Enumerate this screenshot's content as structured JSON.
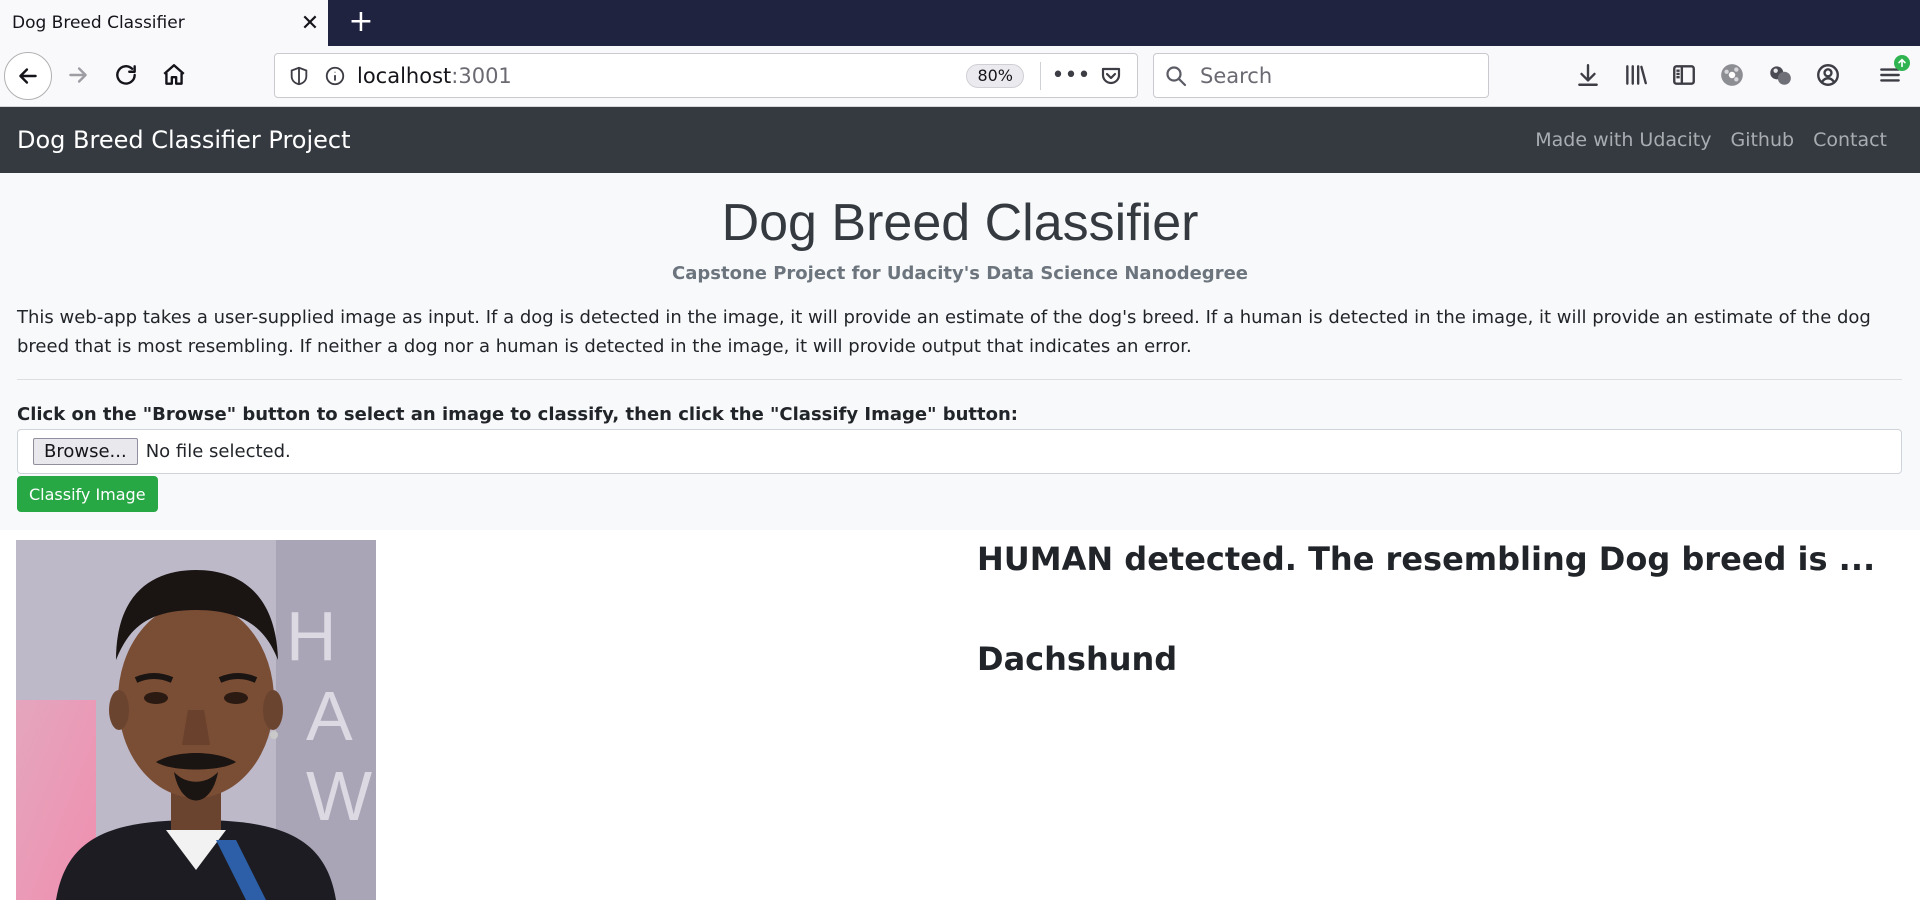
{
  "browser": {
    "tab_title": "Dog Breed Classifier",
    "url_host": "localhost",
    "url_port": ":3001",
    "zoom": "80%",
    "search_placeholder": "Search"
  },
  "nav": {
    "brand": "Dog Breed Classifier Project",
    "links": [
      "Made with Udacity",
      "Github",
      "Contact"
    ]
  },
  "hero": {
    "title": "Dog Breed Classifier",
    "subtitle": "Capstone Project for Udacity's Data Science Nanodegree",
    "description": "This web-app takes a user-supplied image as input. If a dog is detected in the image, it will provide an estimate of the dog's breed. If a human is detected in the image, it will provide an estimate of the dog breed that is most resembling. If neither a dog nor a human is detected in the image, it will provide output that indicates an error.",
    "upload_instruction": "Click on the \"Browse\" button to select an image to classify, then click the \"Classify Image\" button:",
    "browse_label": "Browse...",
    "file_status": "No file selected.",
    "classify_label": "Classify Image"
  },
  "result": {
    "heading": "HUMAN detected. The resembling Dog breed is ...",
    "breed": "Dachshund"
  },
  "colors": {
    "tabbar_bg": "#202340",
    "navbar_bg": "#343a40",
    "classify_green": "#28a745",
    "jumbotron_bg": "#f8f9fa"
  },
  "icons": [
    "back-icon",
    "forward-icon",
    "reload-icon",
    "home-icon",
    "shield-icon",
    "info-icon",
    "more-icon",
    "pocket-icon",
    "search-icon",
    "download-icon",
    "library-icon",
    "sidebar-icon",
    "extension-icon",
    "extension-icon",
    "account-icon",
    "menu-icon",
    "update-icon"
  ]
}
